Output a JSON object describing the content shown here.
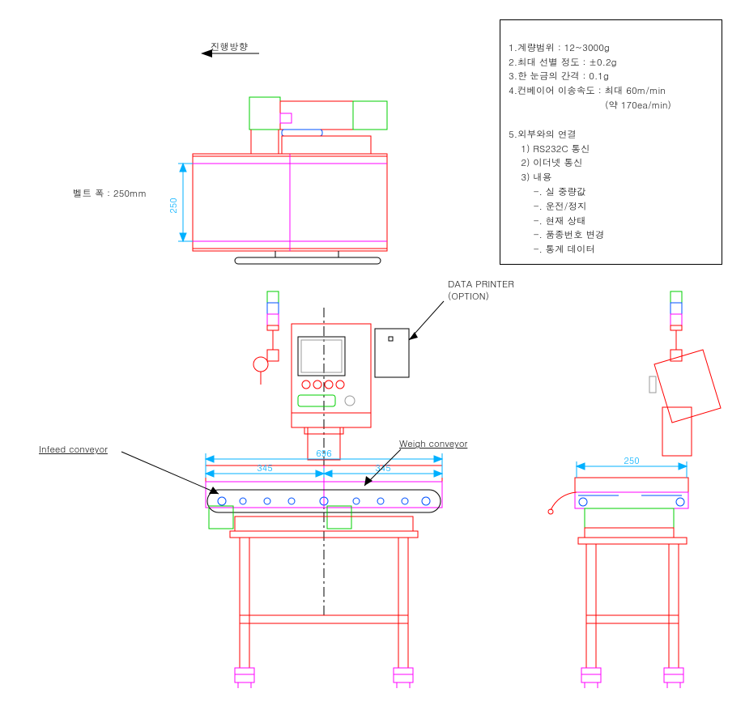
{
  "labels": {
    "direction_arrow": "진행방향",
    "belt_width": "벨트 폭 : 250mm",
    "data_printer_1": "DATA PRINTER",
    "data_printer_2": "(OPTION)",
    "infeed": "Infeed conveyor",
    "weigh": "Weigh conveyor"
  },
  "dims": {
    "top_250": "250",
    "front_696": "696",
    "front_345_l": "345",
    "front_345_r": "345",
    "side_250": "250"
  },
  "spec": {
    "l1": "1.계량범위 : 12~3000g",
    "l2": "2.최대 선별 정도 : ±0.2g",
    "l3": "3.한 눈금의 간격 : 0.1g",
    "l4": "4.컨베이어 이송속도 : 최대 60m/min",
    "l5": "                               (약 170ea/min)",
    "l6": "",
    "l7": "5.외부와의 연결",
    "l8": "    1) RS232C 통신",
    "l9": "    2) 이더넷 통신",
    "l10": "    3) 내용",
    "l11": "        -. 실 중량값",
    "l12": "        -. 운전/정지",
    "l13": "        -. 현재 상태",
    "l14": "        -. 품종번호 변경",
    "l15": "        -. 통계 데이터"
  }
}
